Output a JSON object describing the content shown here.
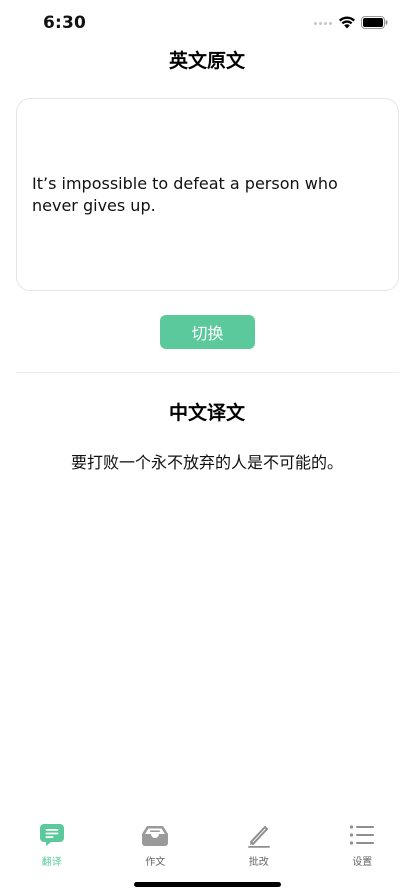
{
  "status_bar": {
    "time": "6:30"
  },
  "source": {
    "title": "英文原文",
    "text": "It’s impossible to defeat a person who never gives up."
  },
  "switch_button": {
    "label": "切换"
  },
  "translation": {
    "title": "中文译文",
    "text": "要打败一个永不放弃的人是不可能的。"
  },
  "tab_bar": {
    "active_color": "#5cc99c",
    "items": [
      {
        "label": "翻译",
        "icon": "chat-bubble-icon",
        "active": true
      },
      {
        "label": "作文",
        "icon": "inbox-tray-icon",
        "active": false
      },
      {
        "label": "批改",
        "icon": "pencil-icon",
        "active": false
      },
      {
        "label": "设置",
        "icon": "list-icon",
        "active": false
      }
    ]
  }
}
